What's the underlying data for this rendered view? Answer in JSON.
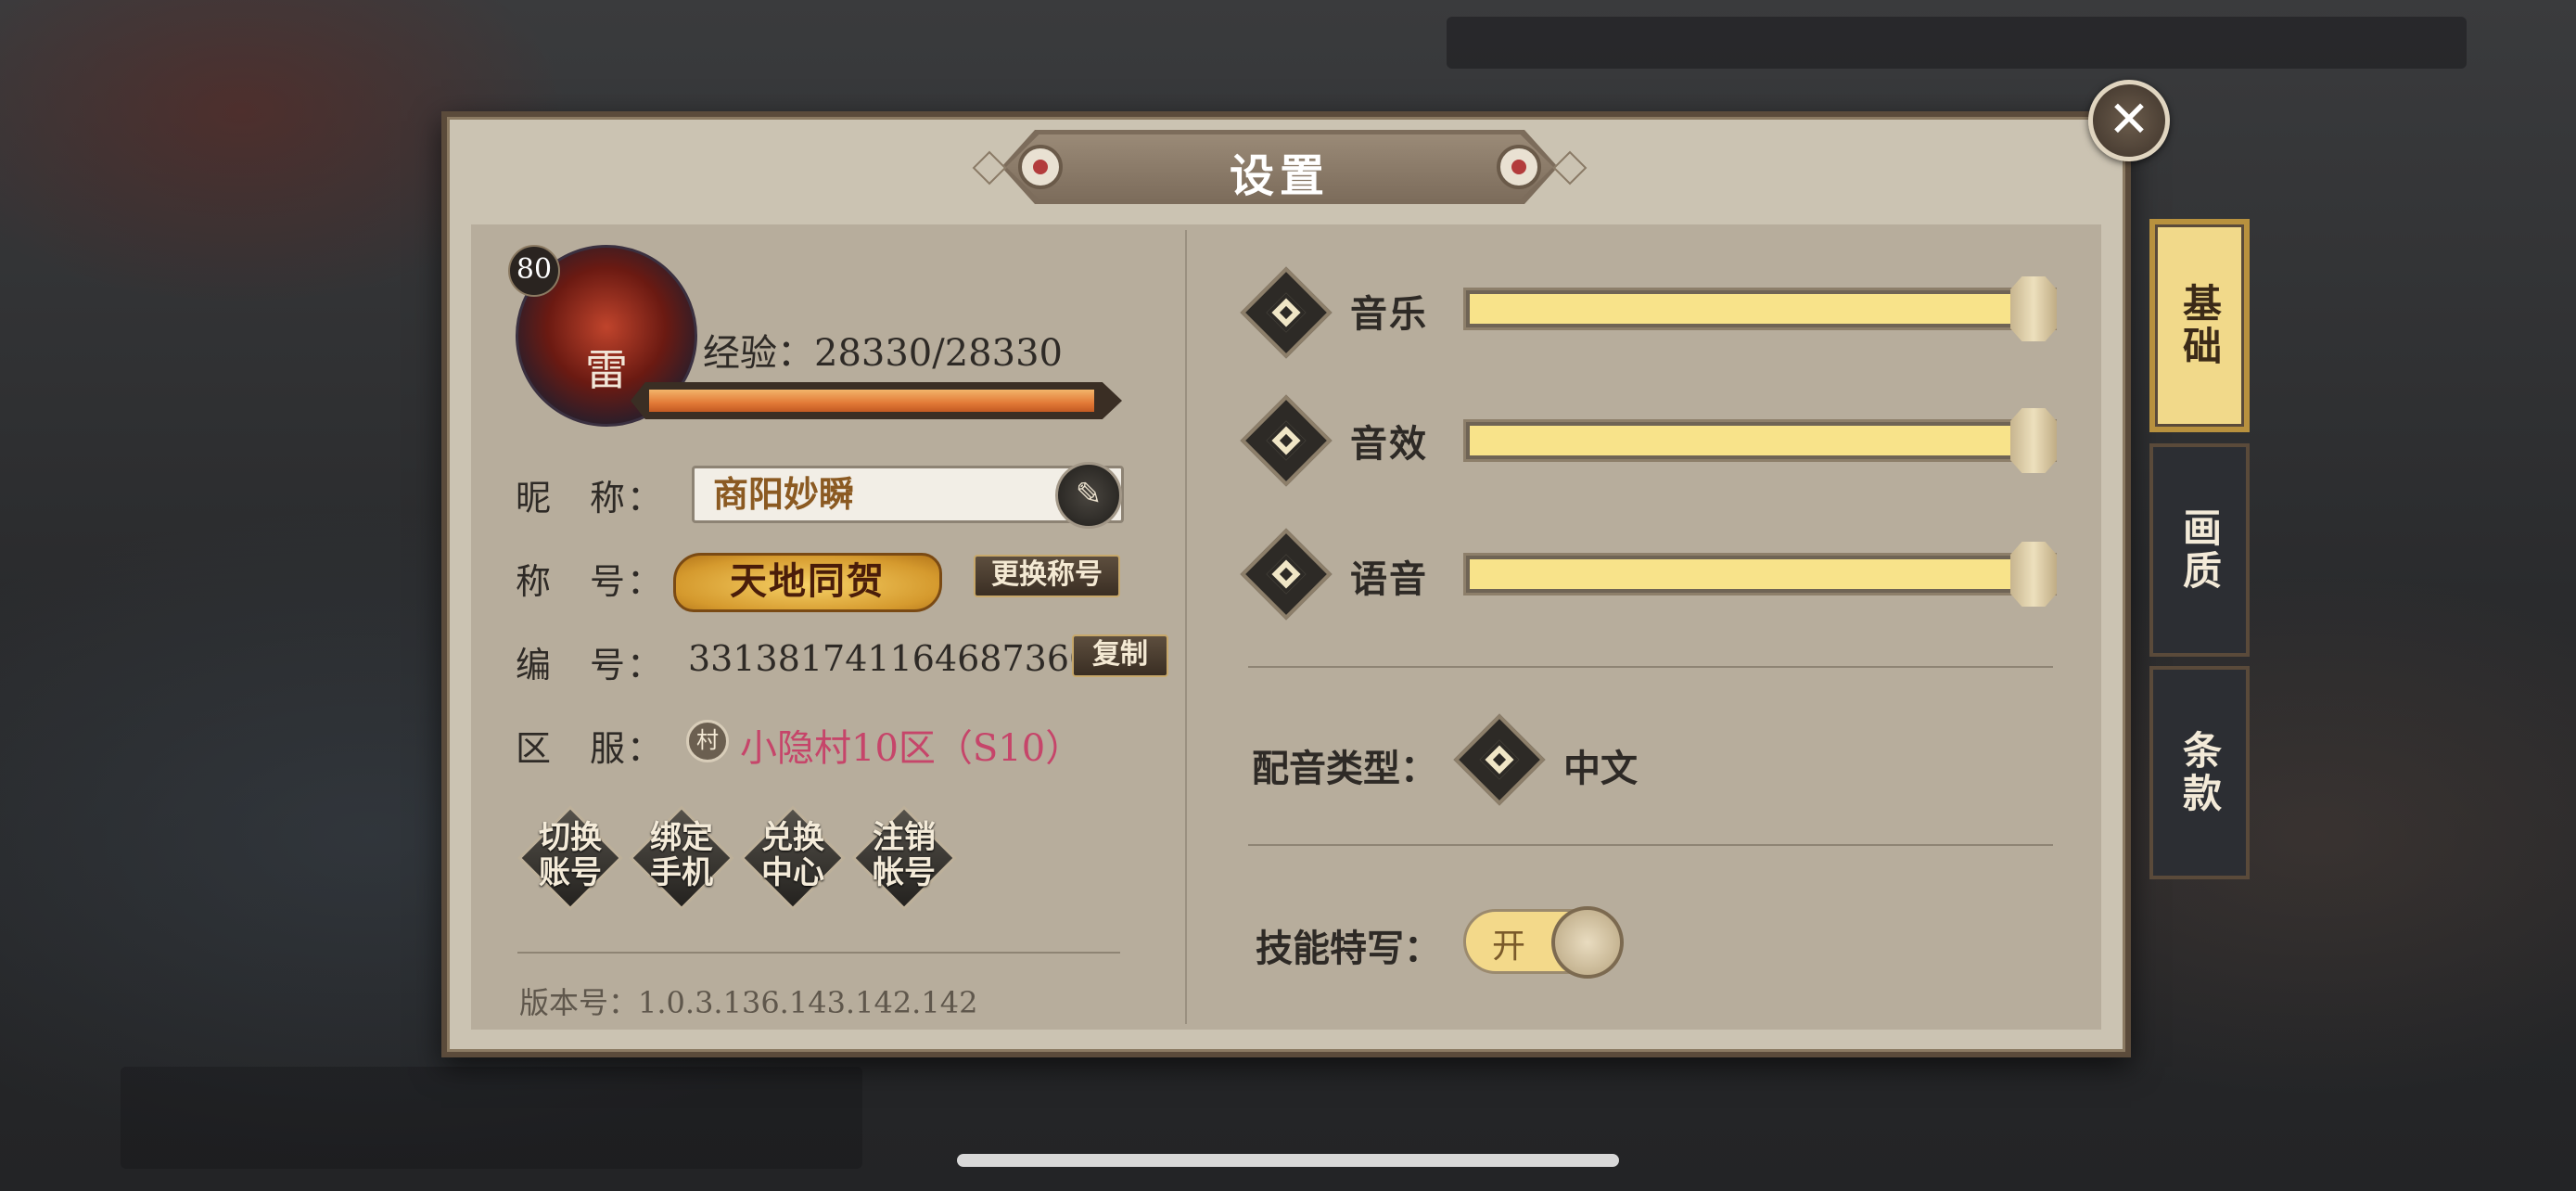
{
  "dialog": {
    "title": "设置",
    "close_icon": "✕"
  },
  "tabs": [
    {
      "label": "基础",
      "active": true
    },
    {
      "label": "画质",
      "active": false
    },
    {
      "label": "条款",
      "active": false
    }
  ],
  "profile": {
    "level": "80",
    "avatar_glyph": "雷",
    "exp_text": "经验：28330/28330",
    "exp_progress": 1.0,
    "nickname_label": "昵　称：",
    "nickname_value": "商阳妙瞬",
    "edit_icon": "✎",
    "title_label": "称　号：",
    "title_badge": "天地同贺",
    "change_title_button": "更换称号",
    "id_label": "编　号：",
    "id_value": "3313817411646873600",
    "copy_button": "复制",
    "server_label": "区　服：",
    "server_icon": "村",
    "server_value": "小隐村10区（S10）"
  },
  "account_buttons": [
    {
      "line1": "切换",
      "line2": "账号"
    },
    {
      "line1": "绑定",
      "line2": "手机"
    },
    {
      "line1": "兑换",
      "line2": "中心"
    },
    {
      "line1": "注销",
      "line2": "帐号"
    }
  ],
  "version": "版本号：1.0.3.136.143.142.142",
  "audio": [
    {
      "label": "音乐",
      "value": 1.0
    },
    {
      "label": "音效",
      "value": 1.0
    },
    {
      "label": "语音",
      "value": 1.0
    }
  ],
  "voice_type": {
    "label": "配音类型：",
    "value": "中文"
  },
  "skill_closeup": {
    "label": "技能特写：",
    "toggle_text": "开",
    "on": true
  },
  "colors": {
    "panel_bg": "#cbc3b2",
    "accent_gold": "#f1d98a",
    "server_pink": "#c6456a",
    "slider_fill": "#f8e38a"
  }
}
